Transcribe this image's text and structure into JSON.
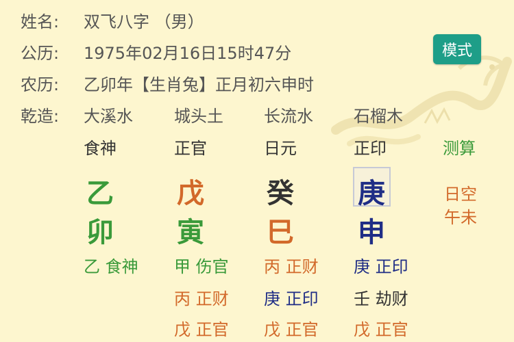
{
  "colors": {
    "background": "#fdf6cf",
    "accent_button": "#1e9e88",
    "green": "#3a9a3a",
    "orange": "#d2692a",
    "navy": "#1f2d86",
    "dark": "#333333"
  },
  "header": {
    "name_label": "姓名:",
    "name_value": "双飞八字 （男）",
    "solar_label": "公历:",
    "solar_value": "1975年02月16日15时47分",
    "lunar_label": "农历:",
    "lunar_value": "乙卯年【生肖兔】正月初六申时",
    "mode_button": "模式"
  },
  "qianzao": {
    "label": "乾造:",
    "nayin": [
      "大溪水",
      "城头土",
      "长流水",
      "石榴木"
    ],
    "shishen": [
      "食神",
      "正官",
      "日元",
      "正印"
    ],
    "calc_link": "测算",
    "stems": [
      "乙",
      "戊",
      "癸",
      "庚"
    ],
    "branches": [
      "卯",
      "寅",
      "巳",
      "申"
    ],
    "kong_line1": "日空",
    "kong_line2": "午未"
  },
  "hidden_stems": {
    "col1": [
      {
        "stem": "乙",
        "god": "食神"
      }
    ],
    "col2": [
      {
        "stem": "甲",
        "god": "伤官"
      },
      {
        "stem": "丙",
        "god": "正财"
      },
      {
        "stem": "戊",
        "god": "正官"
      }
    ],
    "col3": [
      {
        "stem": "丙",
        "god": "正财"
      },
      {
        "stem": "庚",
        "god": "正印"
      },
      {
        "stem": "戊",
        "god": "正官"
      }
    ],
    "col4": [
      {
        "stem": "庚",
        "god": "正印"
      },
      {
        "stem": "壬",
        "god": "劫财"
      },
      {
        "stem": "戊",
        "god": "正官"
      }
    ]
  }
}
